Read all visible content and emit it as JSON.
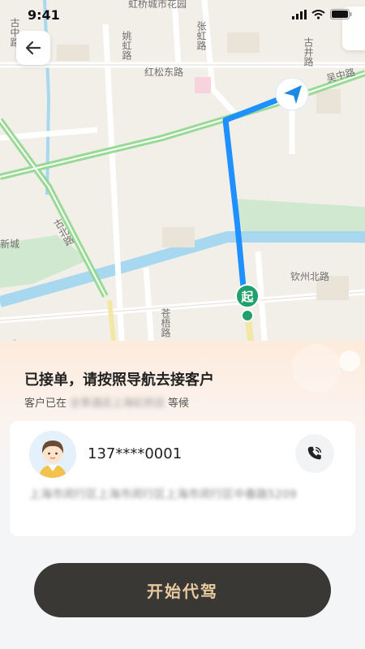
{
  "status_bar": {
    "time": "9:41"
  },
  "map": {
    "labels": {
      "garden": "虹桥城市花园",
      "yaohong": "姚虹路",
      "zhanghong": "张虹路",
      "hongsong": "红松东路",
      "gujing": "古井路",
      "wuzhong": "吴中路",
      "gubei": "古北路",
      "xincheng": "新城",
      "qinzhou": "钦州北路",
      "canghui": "苍梧路",
      "gurong": "古中路"
    },
    "start_marker": "起",
    "route_color": "#1e90ff"
  },
  "panel": {
    "title": "已接单，请按照导航去接客户",
    "sub_prefix": "客户已在",
    "sub_location": "全季酒店上海虹桥店",
    "sub_suffix": "等候",
    "phone": "137****0001",
    "address": "上海市闵行区上海市闵行区上海市闵行区中春路5209",
    "start_button": "开始代驾"
  },
  "colors": {
    "button_bg": "#3a3835",
    "button_text": "#e8c9a0"
  }
}
